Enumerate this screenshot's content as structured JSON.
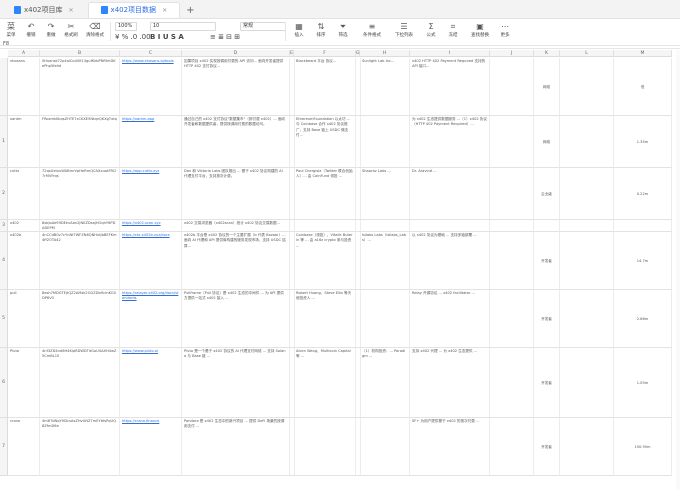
{
  "tabs": [
    {
      "label": "x402项目库",
      "active": false
    },
    {
      "label": "x402项目数据",
      "active": true
    }
  ],
  "toolbar": {
    "items": [
      {
        "icon": "菜",
        "label": "菜单"
      },
      {
        "icon": "↶",
        "label": "撤销"
      },
      {
        "icon": "↷",
        "label": "重做"
      },
      {
        "icon": "✂",
        "label": "格式刷"
      },
      {
        "icon": "⌫",
        "label": "清除格式"
      }
    ],
    "zoom": "100%",
    "font_size": "10",
    "font_name": "常规",
    "right_items": [
      {
        "icon": "▦",
        "label": "插入"
      },
      {
        "icon": "⇅",
        "label": "排序"
      },
      {
        "icon": "⏷",
        "label": "筛选"
      },
      {
        "icon": "≡",
        "label": "条件格式"
      },
      {
        "icon": "☰",
        "label": "下拉列表"
      },
      {
        "icon": "Σ",
        "label": "公式"
      },
      {
        "icon": "⌗",
        "label": "冻结"
      },
      {
        "icon": "▣",
        "label": "查找替换"
      },
      {
        "icon": "⋯",
        "label": "更多"
      }
    ]
  },
  "formula_bar": "F8",
  "columns": [
    "A",
    "B",
    "C",
    "D",
    "E",
    "F",
    "G",
    "H",
    "I",
    "J",
    "K",
    "L",
    "M"
  ],
  "rows": [
    {
      "num": "",
      "cells": [
        "xhosans",
        "0Hxansk72p4alCo4i0f13gufKkbPNRhhDKePhp5fehd",
        "https://www.xhosans.io/tools",
        "如果项目 x402 实现按调用付费的 API 访问... 面向开发者提供 HTTP 402 支付协议...",
        "",
        "Blackbeard 平台 协议...",
        "",
        "Sunlight Lab Inc...",
        "x402 HTTP 402 Payment Required 支持的 API 接口...",
        "",
        "网络",
        "",
        "低"
      ]
    },
    {
      "num": "1",
      "cells": [
        "xantm",
        "FRozmkKkqsZHTE7zCKXE5NtqnQKXgTxtq",
        "https://xantm.app",
        "通过自己的 x402 支付协议\"数据集市\"（即付费 x402）... 面向开发者和数据提供者，提供按调用付费的数据访问。",
        "",
        "EthereumFoundation 以太坊 ... 与 Coinbase 合作 x402 协议推广，支持 Base 链上 USDC 微支付...",
        "",
        "",
        "为 x402 生态提供数据服务 ...（1）x402 协议（HTTP 402 Payment Required）...",
        "",
        "网络",
        "",
        "1.35m"
      ]
    },
    {
      "num": "2",
      "cells": [
        "cuttx",
        "72qsUxtxuWABmrVpHeRmQCAXxuotFRCl7rMVFrqs",
        "https://app.cuttx.xyz",
        "Dan 和 Viktoria Labs 团队推出 ... 基于 x402 协议构建的 AI 代理支付平台，支持按次计费。",
        "",
        "Paul Chergisla（Twitter 联合创始人）... 由 CoinFund 领投 ...",
        "",
        "Shaarav Labs ...",
        "Dr. Aravind ...",
        "",
        "企业级",
        "",
        "0.22m"
      ]
    },
    {
      "num": "3",
      "cells": [
        "x402",
        "8sbJoAe99DEkvAbn2JNKZDsajHOqhY6PDADEPM",
        "https://x402.scan.xyz",
        "x402 交易浏览器（x402scan）统计 x402 协议交易数据...",
        "",
        "",
        "",
        "",
        "",
        "",
        "",
        "",
        ""
      ]
    },
    {
      "num": "4",
      "cells": [
        "x402b",
        "4nCCdB0v7cYnNf7WFZN6QNHxtJbBEFKm4ff2OTA42",
        "https://ctx.x402b.xyz/docs",
        "x402b 平台是 x402 协议的一个主要扩展（b 代表 Bazaar）... 面向 AI 代理和 API 提供商构建的服务发现市场，支持 USDC 结算...",
        "",
        "Coinbase（领投）、Vitalik Buterin 等 ... 由 a16z crypto 参与投资 ...",
        "",
        "Isilabs Labs（Isilabs_Labs）...",
        "以 x402 协议为基础 ... 支持多链部署 ...",
        "",
        "开发者",
        "",
        "14.7m"
      ]
    },
    {
      "num": "5",
      "cells": [
        "pull",
        "8esh7MDGTEjtQZ2AMzk2GGZDb9cmKG0DP6V0",
        "https://relayer.x402.org/docs/standards",
        "Pullframe（Pull 协议）是 x402 生态的中间件 ... 为 API 提供方提供一站式 x402 接入 ...",
        "",
        "Robert Huang、Steve Ellis 等天使投资人 ...",
        "",
        "",
        "Relay 开源协议 ... x402 facilitator ...",
        "",
        "开发者",
        "",
        "2.66m"
      ]
    },
    {
      "num": "6",
      "cells": [
        "Pluto",
        "4nf3ZD4nd6H4KlpRDWDTdGoU4AXH4wZ5CmBL10",
        "https://www.pluto.ai",
        "Pluto 是一个基于 x402 协议的 AI 代理支付网络 ... 支持 Solana 与 Base 链 ...",
        "",
        "Alcen Wang、Multicoin Capital 等 ...",
        "",
        "（1）机构投资：... Paradigm ...",
        "支持 x402 代理 ... 为 x402 生态提供 ...",
        "",
        "开发者",
        "",
        "1.05m"
      ]
    },
    {
      "num": "7",
      "cells": [
        "crano",
        "4m6TdNqYHDcsAsZHvUNZ7mEYbfsPqUQ8ZfmD6e",
        "https://crano.finance",
        "Pandora 是 x402 生态中的新兴项目 ... 提供 DeFi 场景的按调用支付 ...",
        "",
        "",
        "",
        "",
        "SF+ 为用户提供基于 x402 的按次付费 ...",
        "",
        "开发者",
        "",
        "150.95m"
      ]
    }
  ]
}
